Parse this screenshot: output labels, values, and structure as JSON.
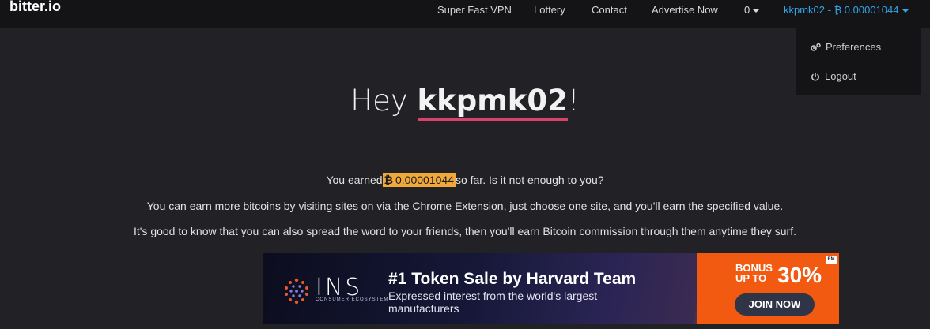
{
  "nav": {
    "brand": "bitter.io",
    "links": [
      "Super Fast VPN",
      "Lottery",
      "Contact",
      "Advertise Now"
    ],
    "counter": "0",
    "account": "kkpmk02 - ₿ 0.00001044",
    "dropdown": {
      "preferences": "Preferences",
      "logout": "Logout"
    }
  },
  "main": {
    "greeting_prefix": "Hey",
    "username": "kkpmk02",
    "greeting_suffix": "!",
    "earned_prefix": "You earned",
    "btc_symbol": "₿",
    "earned_amount": "0.00001044",
    "earned_suffix": "so far. Is it not enough to you?",
    "line2": "You can earn more bitcoins by visiting sites on via the Chrome Extension, just choose one site, and you'll earn the specified value.",
    "line3": "It's good to know that you can also spread the word to your friends, then you'll earn Bitcoin commission through them anytime they surf."
  },
  "ad": {
    "logo_text": "INS",
    "logo_sub": "CONSUMER ECOSYSTEM",
    "title": "#1 Token Sale by Harvard Team",
    "desc": "Expressed interest from the world's largest manufacturers",
    "bonus_line1": "BONUS",
    "bonus_line2": "UP TO",
    "bonus_pct": "30%",
    "cta": "JOIN NOW",
    "badge": "EM"
  },
  "colors": {
    "navbar_bg": "#141417",
    "page_bg": "#222226",
    "account_link": "#33a6e8",
    "underline": "#d9426b",
    "highlight": "#f2a93b",
    "ad_orange": "#f25a12"
  }
}
